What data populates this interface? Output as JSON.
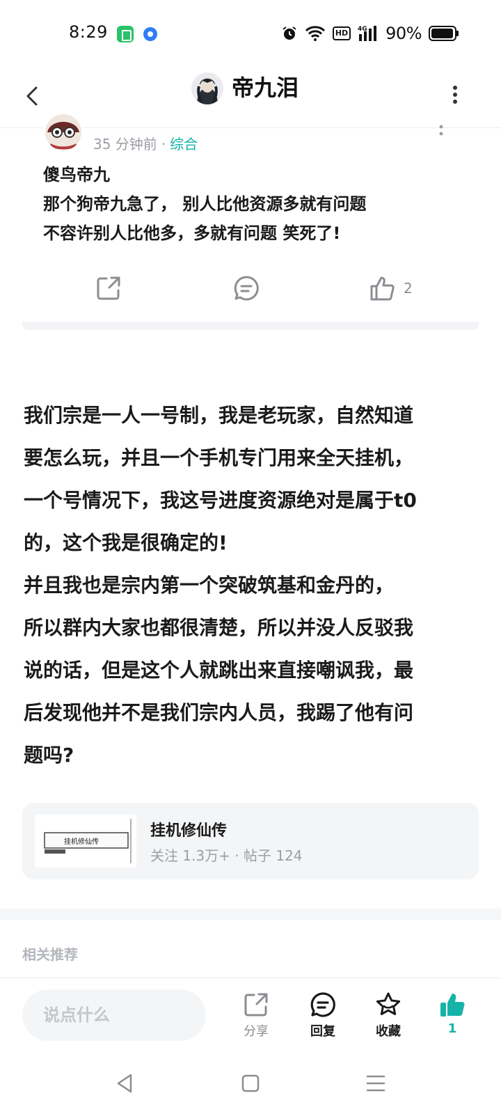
{
  "status_bar": {
    "time": "8:29",
    "battery": "90%",
    "network_label": "HD",
    "signal_label": "4G",
    "icons": [
      "app-notification-icon",
      "browser-notification-icon",
      "alarm-icon",
      "wifi-icon",
      "hd-icon",
      "signal-icon",
      "battery-icon"
    ]
  },
  "header": {
    "title": "帝九泪",
    "icons": [
      "back-icon",
      "avatar",
      "more-icon"
    ]
  },
  "quoted_post": {
    "time_ago": "35 分钟前",
    "separator": "·",
    "category": "综合",
    "lines": [
      "傻鸟帝九",
      "那个狗帝九急了， 别人比他资源多就有问题",
      "不容许别人比他多，多就有问题 笑死了!"
    ],
    "like_count": "2",
    "category_color": "#13b3a8"
  },
  "main_text": {
    "lines": [
      "我们宗是一人一号制，我是老玩家，自然知道",
      "要怎么玩，并且一个手机专门用来全天挂机，",
      "一个号情况下，我这号进度资源绝对是属于t0",
      "的，这个我是很确定的!",
      "并且我也是宗内第一个突破筑基和金丹的，",
      "所以群内大家也都很清楚，所以并没人反驳我",
      "说的话，但是这个人就跳出来直接嘲讽我，最",
      "后发现他并不是我们宗内人员，我踢了他有问",
      "题吗?"
    ]
  },
  "forum": {
    "name": "挂机修仙传",
    "followers": "关注 1.3万+",
    "separator": "·",
    "posts": "帖子 124",
    "thumb_text": "挂机修仙传"
  },
  "related": {
    "label": "相关推荐"
  },
  "bottom_bar": {
    "input_placeholder": "说点什么",
    "share_label": "分享",
    "reply_label": "回复",
    "favorite_label": "收藏",
    "like_count": "1",
    "accent_color": "#15b3a8"
  },
  "system_nav": {
    "icons": [
      "nav-back-icon",
      "nav-home-icon",
      "nav-menu-icon"
    ]
  }
}
